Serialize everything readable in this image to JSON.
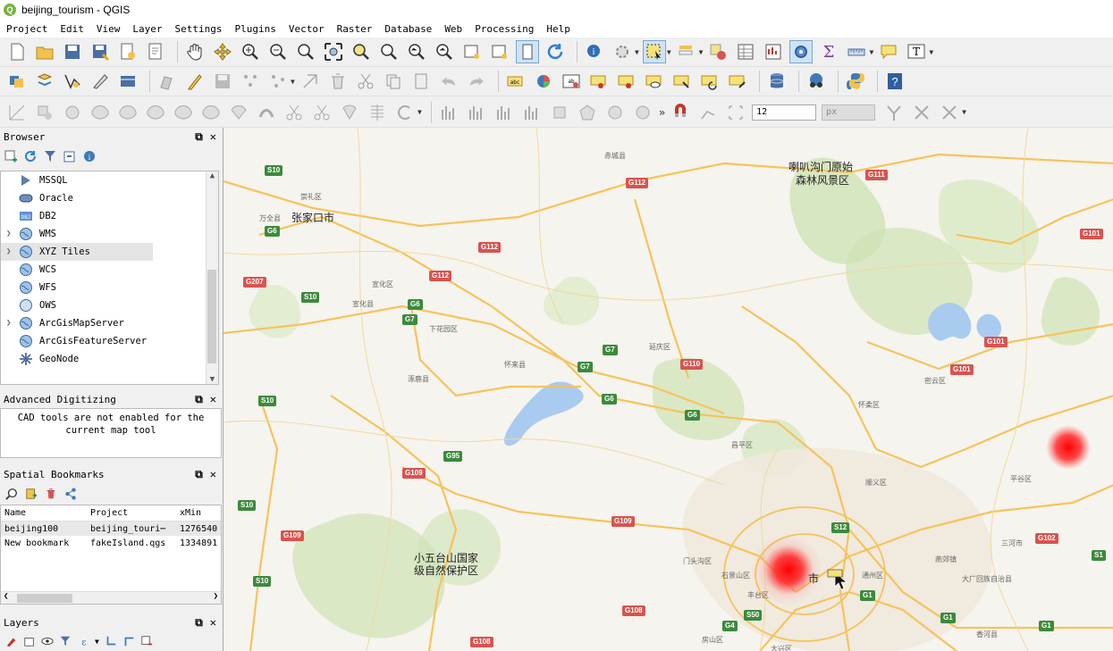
{
  "window": {
    "title": "beijing_tourism - QGIS",
    "logo_letter": "Q"
  },
  "menu": [
    "Project",
    "Edit",
    "View",
    "Layer",
    "Settings",
    "Plugins",
    "Vector",
    "Raster",
    "Database",
    "Web",
    "Processing",
    "Help"
  ],
  "digitizing": {
    "snap_size": "12",
    "snap_unit": "px"
  },
  "browser": {
    "title": "Browser",
    "items": [
      {
        "label": "MSSQL",
        "icon": "mssql-icon",
        "expandable": false
      },
      {
        "label": "Oracle",
        "icon": "oracle-icon",
        "expandable": false
      },
      {
        "label": "DB2",
        "icon": "db2-icon",
        "expandable": false
      },
      {
        "label": "WMS",
        "icon": "globe-icon",
        "expandable": true
      },
      {
        "label": "XYZ Tiles",
        "icon": "globe-icon",
        "expandable": true,
        "selected": true
      },
      {
        "label": "WCS",
        "icon": "globe-icon",
        "expandable": false
      },
      {
        "label": "WFS",
        "icon": "globe-icon",
        "expandable": false
      },
      {
        "label": "OWS",
        "icon": "globe-icon",
        "expandable": false
      },
      {
        "label": "ArcGisMapServer",
        "icon": "globe-icon",
        "expandable": true
      },
      {
        "label": "ArcGisFeatureServer",
        "icon": "globe-icon",
        "expandable": false
      },
      {
        "label": "GeoNode",
        "icon": "geonode-icon",
        "expandable": false
      }
    ]
  },
  "advanced_digitizing": {
    "title": "Advanced Digitizing",
    "message_line1": "CAD tools are not enabled for the",
    "message_line2": "current map tool"
  },
  "bookmarks": {
    "title": "Spatial Bookmarks",
    "columns": [
      "Name",
      "Project",
      "xMin"
    ],
    "rows": [
      [
        "beijing100",
        "beijing_touri⋯",
        "1276540"
      ],
      [
        "New bookmark",
        "fakeIsland.qgs",
        "1334891"
      ]
    ]
  },
  "layers": {
    "title": "Layers"
  },
  "map": {
    "labels_big": [
      {
        "text": "张家口市"
      },
      {
        "text": "喇叭沟门原始"
      },
      {
        "text": "森林风景区"
      },
      {
        "text": "小五台山国家"
      },
      {
        "text": "级自然保护区"
      },
      {
        "text": "市"
      }
    ],
    "labels_small": [
      "崇礼区",
      "万全县",
      "宣化区",
      "宣化县",
      "下花园区",
      "怀来县",
      "延庆区",
      "涿鹿县",
      "赤城县",
      "昌平区",
      "怀柔区",
      "顺义区",
      "平谷区",
      "三河市",
      "密云区",
      "门头沟区",
      "石景山区",
      "丰台区",
      "通州区",
      "大厂回族自治县",
      "香河县",
      "房山区",
      "大兴区",
      "燕郊镇"
    ],
    "shields": [
      "S10",
      "G6",
      "G112",
      "G112",
      "G112",
      "G207",
      "S10",
      "G6",
      "G7",
      "G7",
      "G7",
      "G6",
      "G110",
      "G6",
      "S10",
      "G95",
      "G109",
      "G109",
      "G109",
      "S10",
      "S10",
      "G108",
      "G108",
      "G111",
      "G101",
      "G101",
      "G101",
      "S12",
      "G102",
      "S1",
      "G1",
      "G1",
      "G1",
      "S50",
      "G4"
    ]
  }
}
